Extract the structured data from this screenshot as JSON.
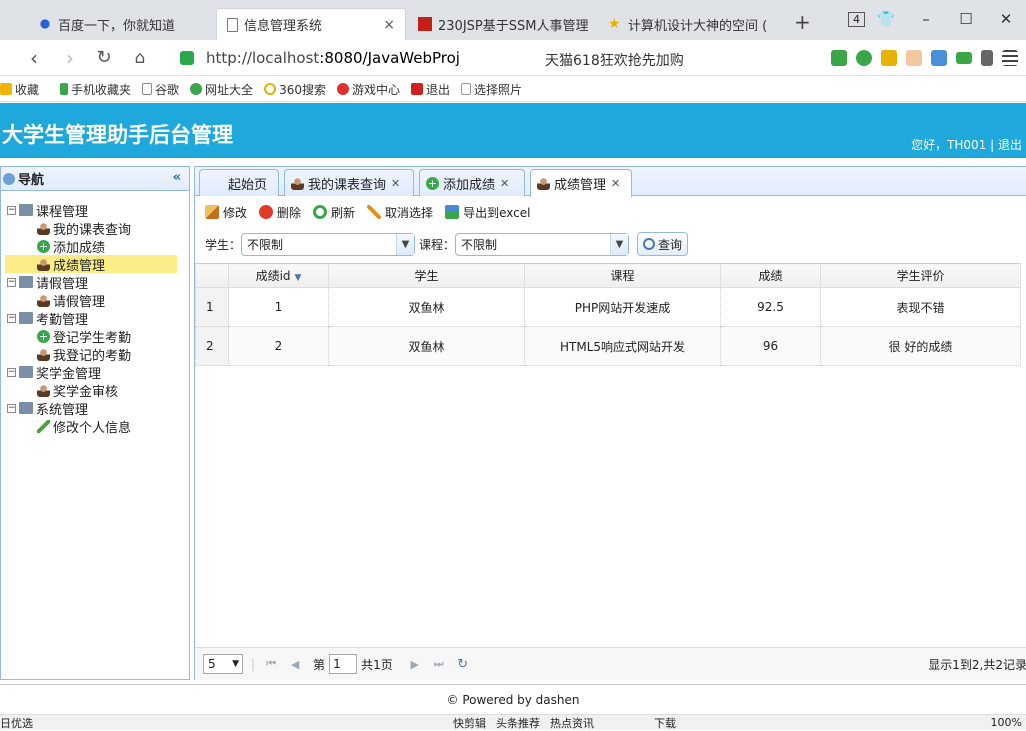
{
  "browser": {
    "tabs": [
      {
        "title": "百度一下，你就知道",
        "icon": "baidu-paw-icon"
      },
      {
        "title": "信息管理系统",
        "icon": "document-icon",
        "close": "×"
      },
      {
        "title": "230JSP基于SSM人事管理",
        "icon": "red-square-icon"
      },
      {
        "title": "计算机设计大神的空间 (",
        "icon": "star-icon"
      }
    ],
    "new_tab": "+",
    "tab_count": "4",
    "url_host": "http://localhost",
    "url_rest": ":8080/JavaWebProj",
    "promo": "天猫618狂欢抢先加购"
  },
  "bookmarks": [
    {
      "label": "收藏",
      "color": "#f0b400"
    },
    {
      "label": "手机收藏夹",
      "color": "#3aa64a"
    },
    {
      "label": "谷歌",
      "color": "#888888"
    },
    {
      "label": "网址大全",
      "color": "#3aa64a"
    },
    {
      "label": "360搜索",
      "color": "#e8b000"
    },
    {
      "label": "游戏中心",
      "color": "#e03030"
    },
    {
      "label": "退出",
      "color": "#d02020"
    },
    {
      "label": "选择照片",
      "color": "#999999"
    }
  ],
  "app": {
    "title": "大学生管理助手后台管理",
    "greeting": "您好，TH001 | 退出",
    "header_color": "#1ea8dc"
  },
  "sidebar": {
    "title": "导航",
    "collapse": "«",
    "groups": [
      {
        "label": "课程管理",
        "items": [
          {
            "label": "我的课表查询",
            "icon": "user-icon"
          },
          {
            "label": "添加成绩",
            "icon": "add-icon"
          },
          {
            "label": "成绩管理",
            "icon": "user-icon",
            "selected": true
          }
        ]
      },
      {
        "label": "请假管理",
        "items": [
          {
            "label": "请假管理",
            "icon": "user-icon"
          }
        ]
      },
      {
        "label": "考勤管理",
        "items": [
          {
            "label": "登记学生考勤",
            "icon": "add-icon"
          },
          {
            "label": "我登记的考勤",
            "icon": "user-icon"
          }
        ]
      },
      {
        "label": "奖学金管理",
        "items": [
          {
            "label": "奖学金审核",
            "icon": "user-icon"
          }
        ]
      },
      {
        "label": "系统管理",
        "items": [
          {
            "label": "修改个人信息",
            "icon": "pencil-icon"
          }
        ]
      }
    ]
  },
  "panel_tabs": [
    {
      "label": "起始页",
      "closable": false
    },
    {
      "label": "我的课表查询",
      "closable": true
    },
    {
      "label": "添加成绩",
      "closable": true
    },
    {
      "label": "成绩管理",
      "closable": true,
      "active": true
    }
  ],
  "toolbar": {
    "edit": "修改",
    "delete": "删除",
    "refresh": "刷新",
    "cancel_select": "取消选择",
    "export": "导出到excel"
  },
  "filters": {
    "student_label": "学生：",
    "student_value": "不限制",
    "course_label": "课程：",
    "course_value": "不限制",
    "query": "查询"
  },
  "grid": {
    "columns": [
      "成绩id",
      "学生",
      "课程",
      "成绩",
      "学生评价"
    ],
    "rows": [
      {
        "rownum": "1",
        "id": "1",
        "student": "双鱼林",
        "course": "PHP网站开发速成",
        "score": "92.5",
        "comment": "表现不错"
      },
      {
        "rownum": "2",
        "id": "2",
        "student": "双鱼林",
        "course": "HTML5响应式网站开发",
        "score": "96",
        "comment": "很 好的成绩"
      }
    ]
  },
  "pager": {
    "page_size": "5",
    "page_label_pre": "第",
    "page_value": "1",
    "page_label_post": "共1页",
    "info": "显示1到2,共2记录"
  },
  "footer": "© Powered by dashen",
  "status": {
    "left": "日优选",
    "items": [
      "快剪辑",
      "头条推荐",
      "热点资讯",
      "下载",
      "100%"
    ]
  }
}
